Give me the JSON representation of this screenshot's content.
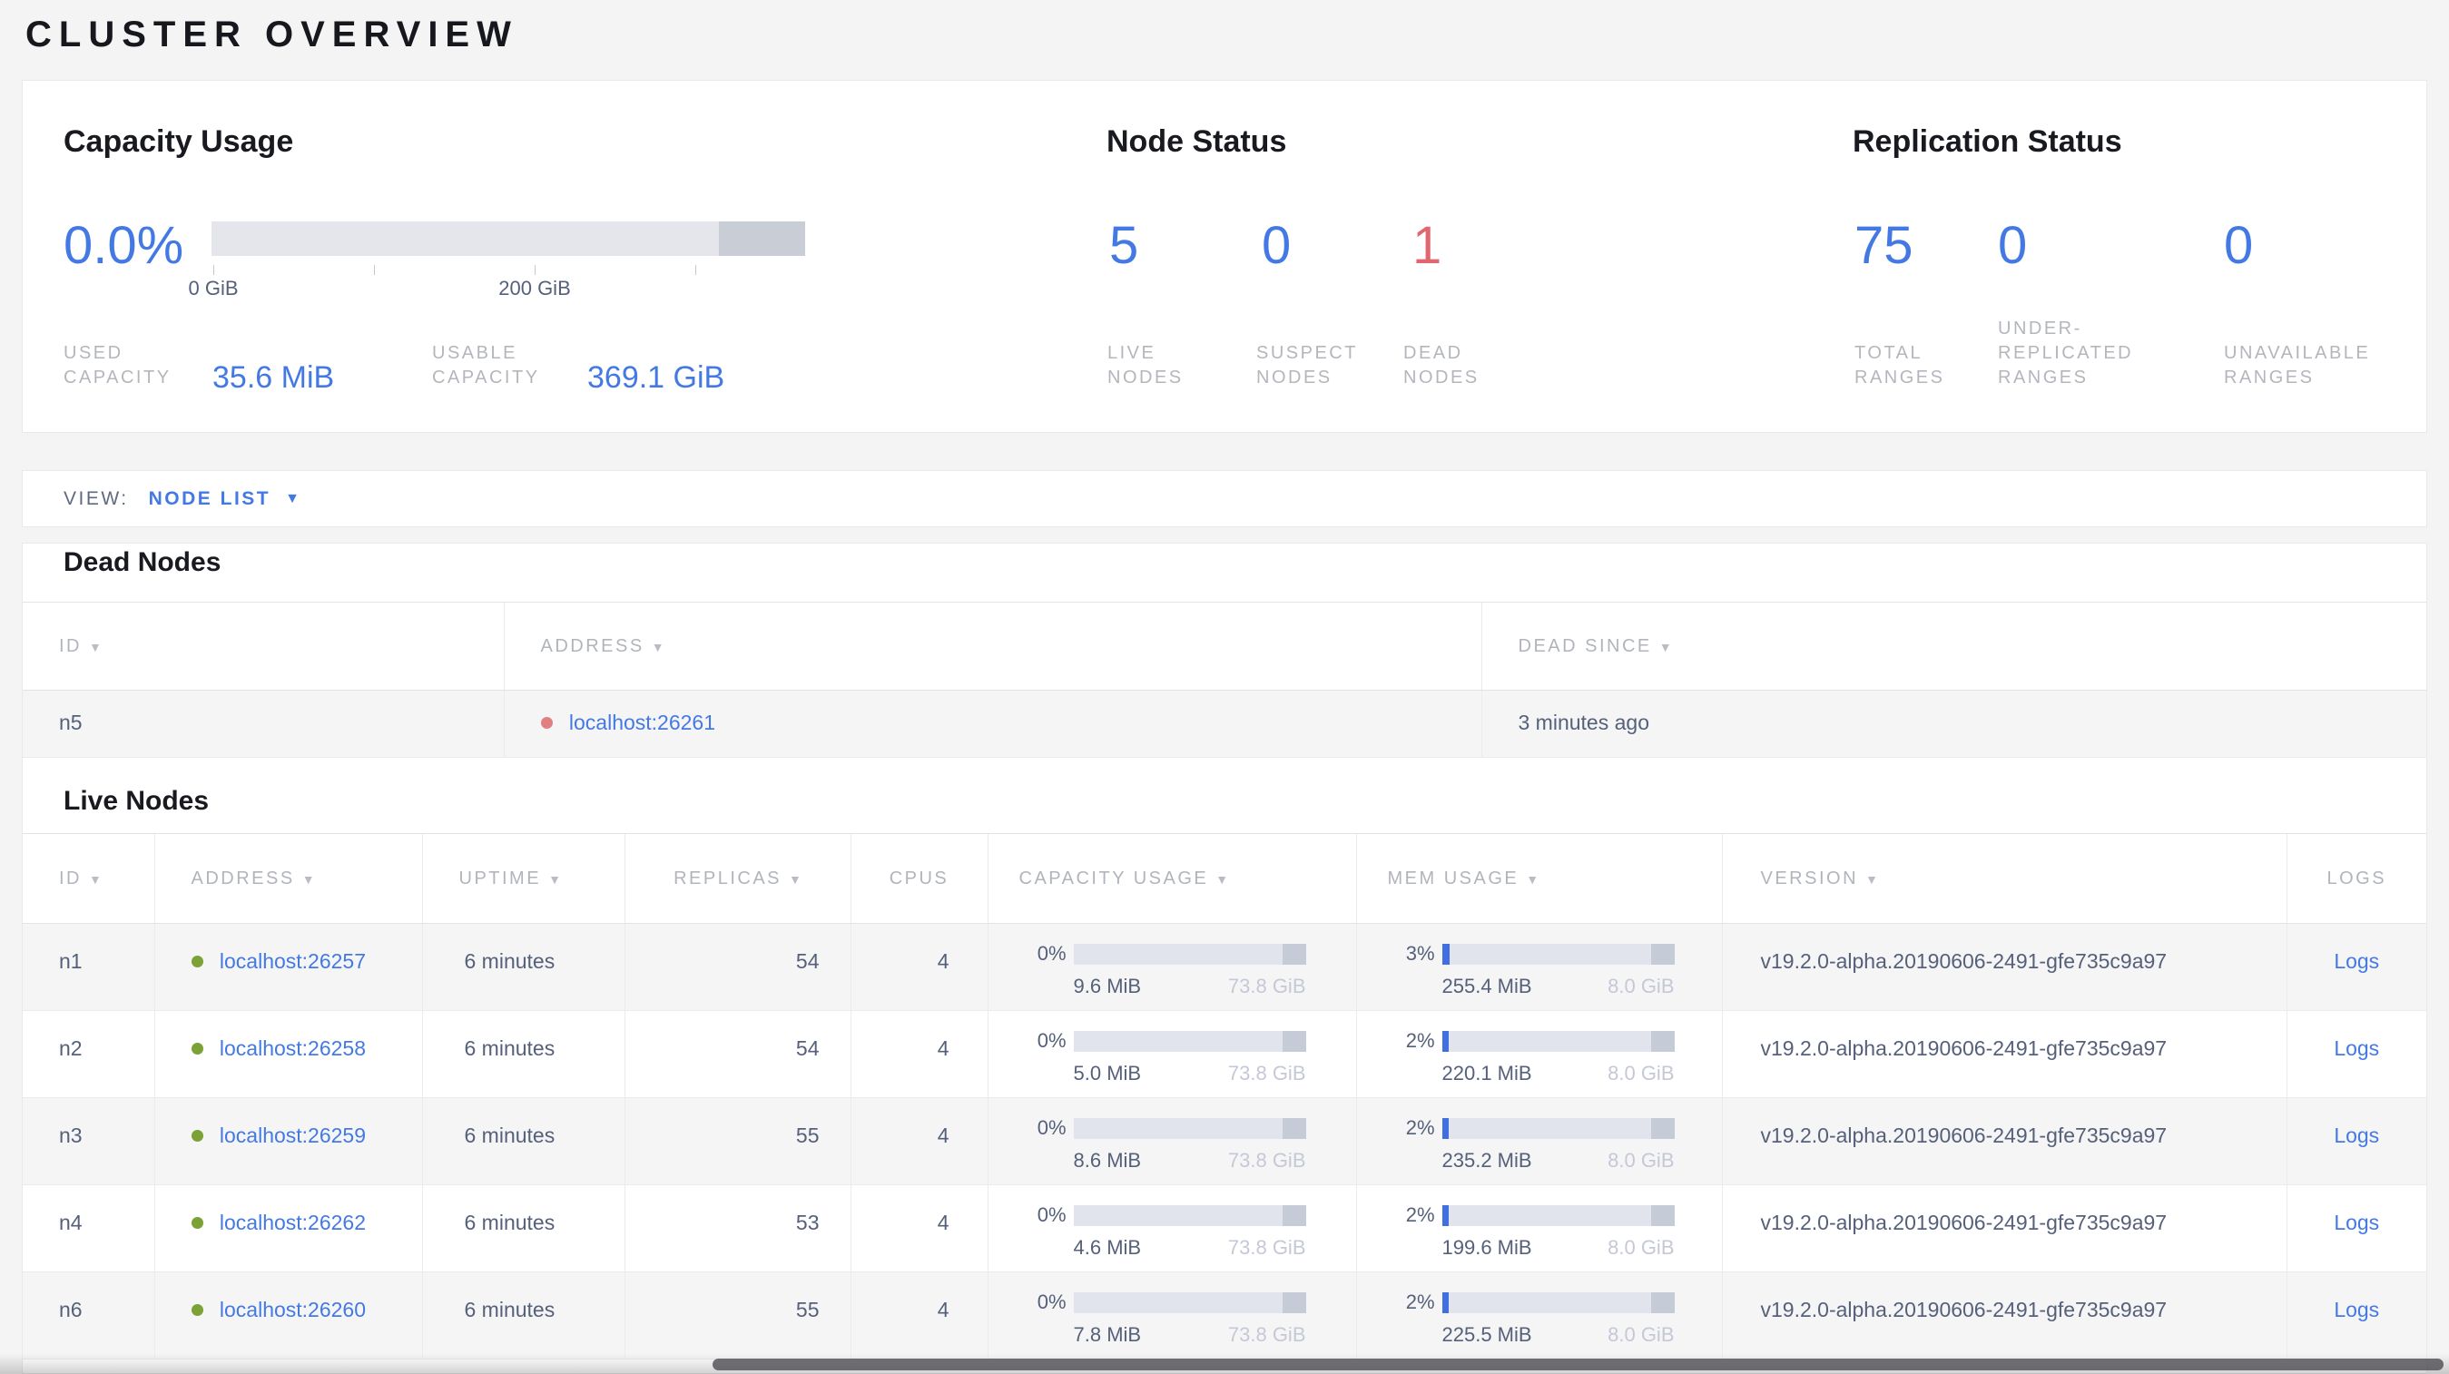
{
  "colors": {
    "accent_blue": "#4479e4",
    "status_red": "#e0676e",
    "live_green": "#7aa234",
    "dead_dot_red": "#e08080",
    "bar_track": "#e2e4ed",
    "bar_endcap": "#c6cbd8",
    "bar_fill_blue": "#3f6fe0"
  },
  "page": {
    "title": "CLUSTER OVERVIEW"
  },
  "summary": {
    "capacity": {
      "title": "Capacity Usage",
      "percent": "0.0%",
      "tick_labels": [
        "0 GiB",
        "200 GiB"
      ],
      "stats": [
        {
          "label": "USED CAPACITY",
          "value": "35.6 MiB"
        },
        {
          "label": "USABLE CAPACITY",
          "value": "369.1 GiB"
        }
      ]
    },
    "node_status": {
      "title": "Node Status",
      "items": [
        {
          "value": "5",
          "label": "LIVE NODES",
          "tone": "blue"
        },
        {
          "value": "0",
          "label": "SUSPECT NODES",
          "tone": "blue"
        },
        {
          "value": "1",
          "label": "DEAD NODES",
          "tone": "red"
        }
      ]
    },
    "replication": {
      "title": "Replication Status",
      "items": [
        {
          "value": "75",
          "label": "TOTAL RANGES",
          "tone": "blue"
        },
        {
          "value": "0",
          "label": "UNDER-REPLICATED RANGES",
          "tone": "blue"
        },
        {
          "value": "0",
          "label": "UNAVAILABLE RANGES",
          "tone": "blue"
        }
      ]
    }
  },
  "view_bar": {
    "label": "VIEW:",
    "selected": "NODE LIST",
    "caret": "▼"
  },
  "sort_icon": "▼",
  "dead_nodes": {
    "title": "Dead Nodes",
    "columns": [
      "ID",
      "ADDRESS",
      "DEAD SINCE"
    ],
    "rows": [
      {
        "id": "n5",
        "address": "localhost:26261",
        "dead_since": "3 minutes ago"
      }
    ]
  },
  "live_nodes": {
    "title": "Live Nodes",
    "columns": [
      "ID",
      "ADDRESS",
      "UPTIME",
      "REPLICAS",
      "CPUS",
      "CAPACITY USAGE",
      "MEM USAGE",
      "VERSION",
      "LOGS"
    ],
    "rows": [
      {
        "id": "n1",
        "address": "localhost:26257",
        "uptime": "6 minutes",
        "replicas": "54",
        "cpus": "4",
        "cap_pct": "0%",
        "cap_used": "9.6 MiB",
        "cap_total": "73.8 GiB",
        "mem_pct": "3%",
        "mem_used": "255.4 MiB",
        "mem_total": "8.0 GiB",
        "version": "v19.2.0-alpha.20190606-2491-gfe735c9a97",
        "logs": "Logs"
      },
      {
        "id": "n2",
        "address": "localhost:26258",
        "uptime": "6 minutes",
        "replicas": "54",
        "cpus": "4",
        "cap_pct": "0%",
        "cap_used": "5.0 MiB",
        "cap_total": "73.8 GiB",
        "mem_pct": "2%",
        "mem_used": "220.1 MiB",
        "mem_total": "8.0 GiB",
        "version": "v19.2.0-alpha.20190606-2491-gfe735c9a97",
        "logs": "Logs"
      },
      {
        "id": "n3",
        "address": "localhost:26259",
        "uptime": "6 minutes",
        "replicas": "55",
        "cpus": "4",
        "cap_pct": "0%",
        "cap_used": "8.6 MiB",
        "cap_total": "73.8 GiB",
        "mem_pct": "2%",
        "mem_used": "235.2 MiB",
        "mem_total": "8.0 GiB",
        "version": "v19.2.0-alpha.20190606-2491-gfe735c9a97",
        "logs": "Logs"
      },
      {
        "id": "n4",
        "address": "localhost:26262",
        "uptime": "6 minutes",
        "replicas": "53",
        "cpus": "4",
        "cap_pct": "0%",
        "cap_used": "4.6 MiB",
        "cap_total": "73.8 GiB",
        "mem_pct": "2%",
        "mem_used": "199.6 MiB",
        "mem_total": "8.0 GiB",
        "version": "v19.2.0-alpha.20190606-2491-gfe735c9a97",
        "logs": "Logs"
      },
      {
        "id": "n6",
        "address": "localhost:26260",
        "uptime": "6 minutes",
        "replicas": "55",
        "cpus": "4",
        "cap_pct": "0%",
        "cap_used": "7.8 MiB",
        "cap_total": "73.8 GiB",
        "mem_pct": "2%",
        "mem_used": "225.5 MiB",
        "mem_total": "8.0 GiB",
        "version": "v19.2.0-alpha.20190606-2491-gfe735c9a97",
        "logs": "Logs"
      }
    ]
  }
}
